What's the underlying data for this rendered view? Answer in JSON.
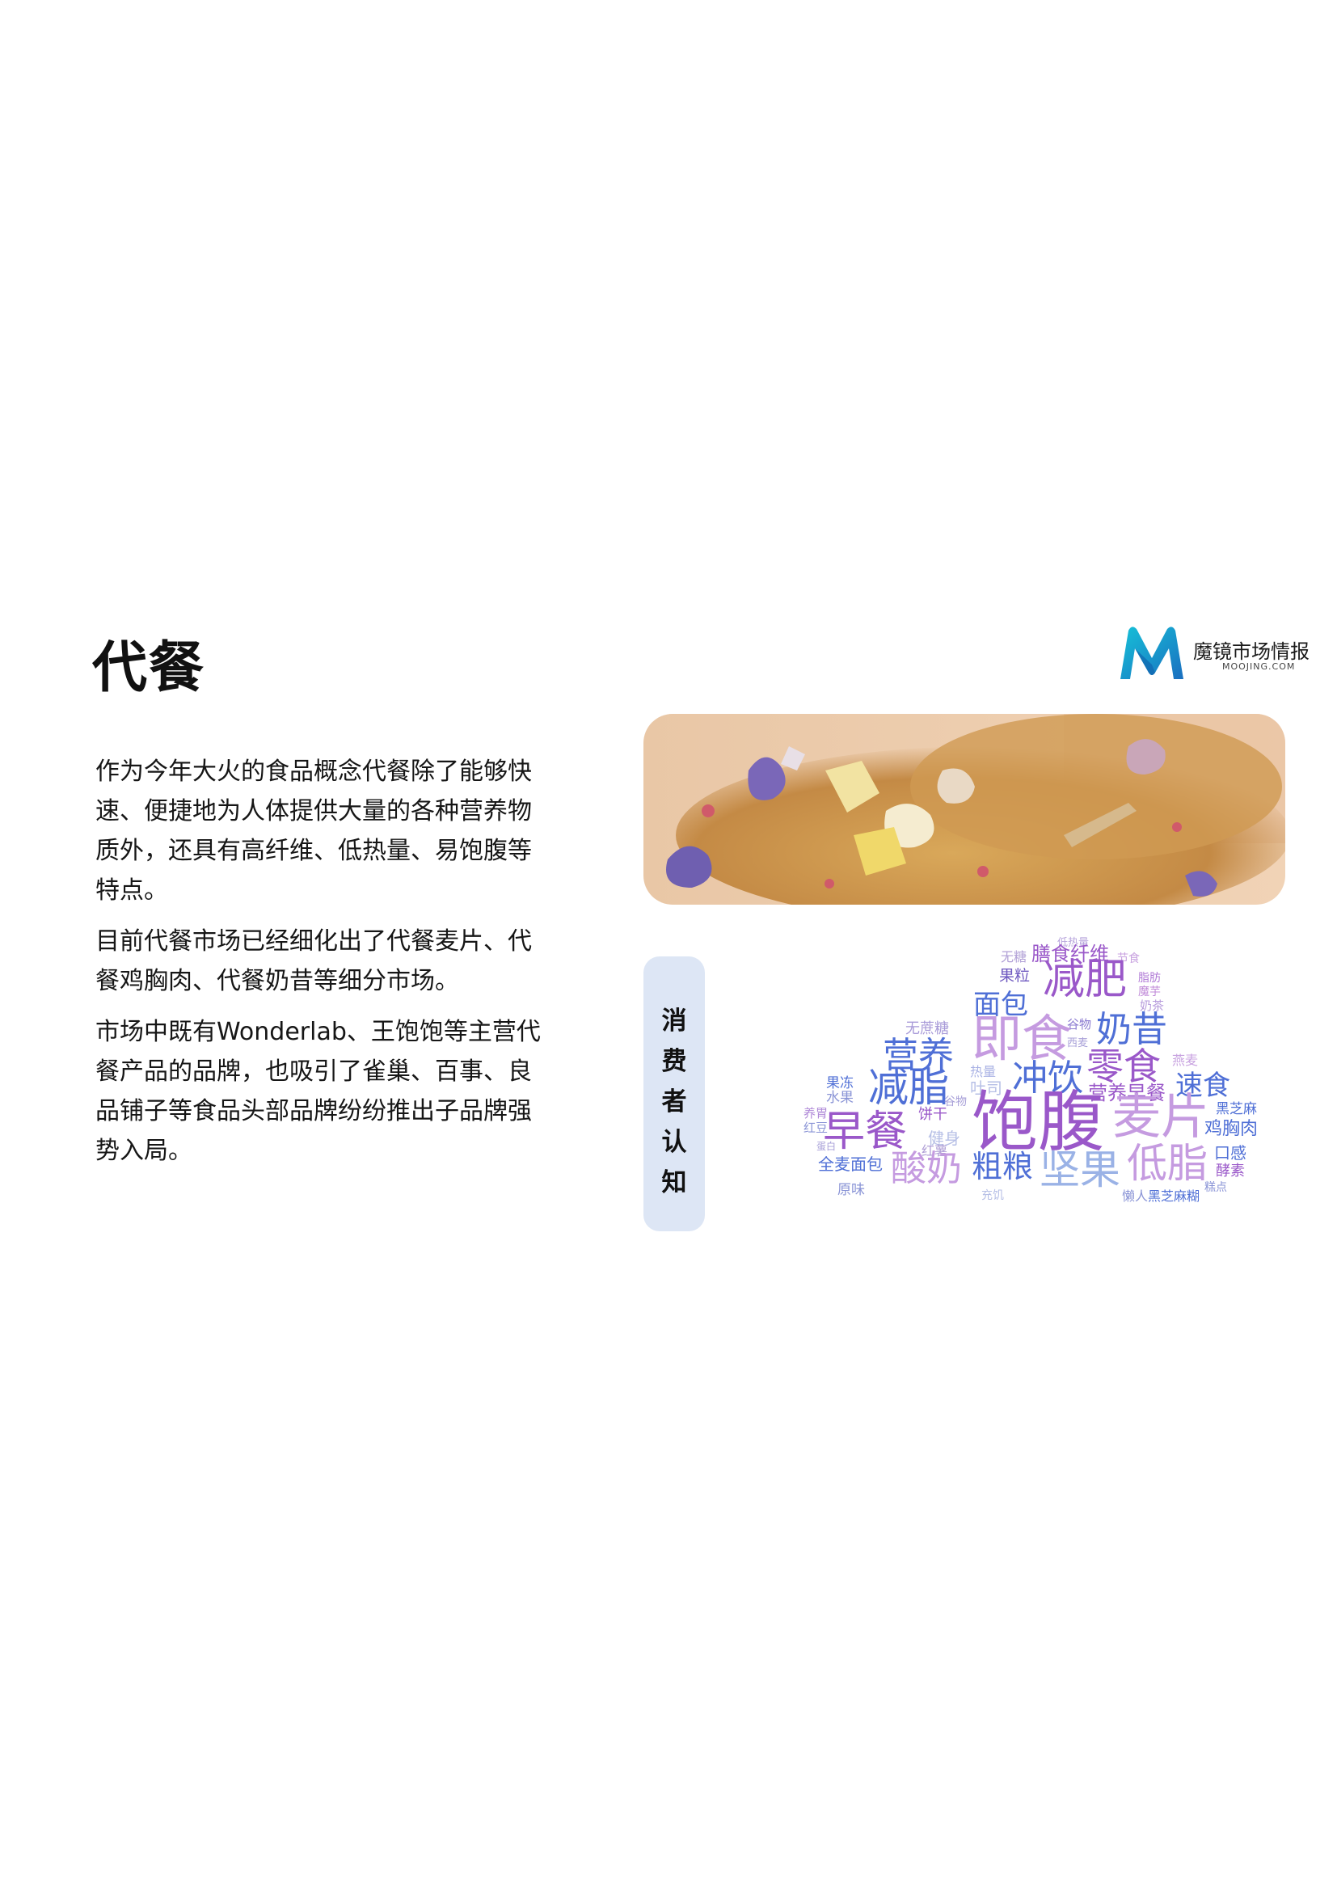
{
  "page": {
    "title": "代餐",
    "logo": {
      "name": "魔镜市场情报",
      "domain": "MOOJING.COM"
    },
    "paragraphs": [
      "作为今年大火的食品概念代餐除了能够快速、便捷地为人体提供大量的各种营养物质外，还具有高纤维、低热量、易饱腹等特点。",
      "目前代餐市场已经细化出了代餐麦片、代餐鸡胸肉、代餐奶昔等细分市场。",
      "市场中既有Wonderlab、王饱饱等主营代餐产品的品牌，也吸引了雀巢、百事、良品铺子等食品头部品牌纷纷推出子品牌强势入局。"
    ],
    "sidebar_label": [
      "消",
      "费",
      "者",
      "认",
      "知"
    ],
    "colors": {
      "brand_teal": "#1aa3c8",
      "label_bg": "#dde6f5",
      "cloud_purple": "#9a58c9",
      "cloud_blue": "#4f6fd6",
      "cloud_lilac": "#c59be0"
    },
    "word_cloud": [
      {
        "text": "低热量"
      },
      {
        "text": "无糖"
      },
      {
        "text": "膳食纤维"
      },
      {
        "text": "节食"
      },
      {
        "text": "果粒"
      },
      {
        "text": "减肥"
      },
      {
        "text": "脂肪"
      },
      {
        "text": "魔芋"
      },
      {
        "text": "面包"
      },
      {
        "text": "奶茶"
      },
      {
        "text": "无蔗糖"
      },
      {
        "text": "谷物"
      },
      {
        "text": "即食"
      },
      {
        "text": "奶昔"
      },
      {
        "text": "营养"
      },
      {
        "text": "西麦"
      },
      {
        "text": "零食"
      },
      {
        "text": "燕麦"
      },
      {
        "text": "热量"
      },
      {
        "text": "冲饮"
      },
      {
        "text": "果冻"
      },
      {
        "text": "减脂"
      },
      {
        "text": "吐司"
      },
      {
        "text": "营养早餐"
      },
      {
        "text": "速食"
      },
      {
        "text": "水果"
      },
      {
        "text": "谷物"
      },
      {
        "text": "黑芝麻"
      },
      {
        "text": "养胃"
      },
      {
        "text": "饼干"
      },
      {
        "text": "饱腹"
      },
      {
        "text": "麦片"
      },
      {
        "text": "红豆"
      },
      {
        "text": "早餐"
      },
      {
        "text": "鸡胸肉"
      },
      {
        "text": "健身"
      },
      {
        "text": "蛋白"
      },
      {
        "text": "红薯"
      },
      {
        "text": "口感"
      },
      {
        "text": "全麦面包"
      },
      {
        "text": "酸奶"
      },
      {
        "text": "粗粮"
      },
      {
        "text": "坚果"
      },
      {
        "text": "低脂"
      },
      {
        "text": "酵素"
      },
      {
        "text": "原味"
      },
      {
        "text": "充饥"
      },
      {
        "text": "懒人"
      },
      {
        "text": "黑芝麻糊"
      },
      {
        "text": "糕点"
      }
    ]
  }
}
